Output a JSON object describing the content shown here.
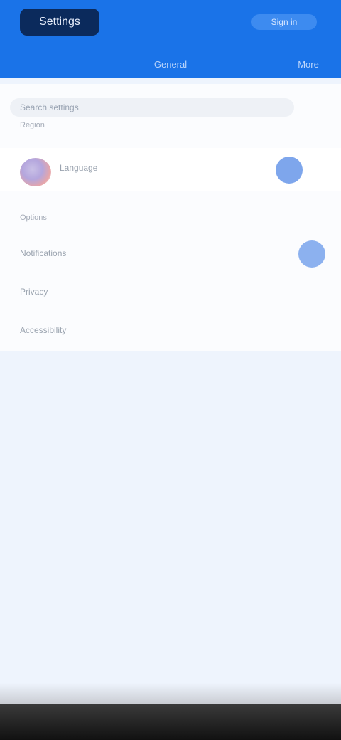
{
  "header": {
    "title": "Settings",
    "action_label": "Sign in"
  },
  "tabs": [
    {
      "label": "General"
    },
    {
      "label": "More"
    }
  ],
  "search": {
    "placeholder": "Search settings"
  },
  "sections": [
    {
      "label": "Region",
      "items": [
        {
          "label": "Language",
          "icon": "flag-icon",
          "toggle": "on"
        }
      ]
    },
    {
      "label": "Options",
      "items": [
        {
          "label": "Notifications",
          "toggle": "on"
        },
        {
          "label": "Privacy"
        },
        {
          "label": "Accessibility"
        }
      ]
    }
  ],
  "colors": {
    "header": "#1a73e8",
    "background": "#eef4fd",
    "toggle_on": "#7ea6ec"
  }
}
